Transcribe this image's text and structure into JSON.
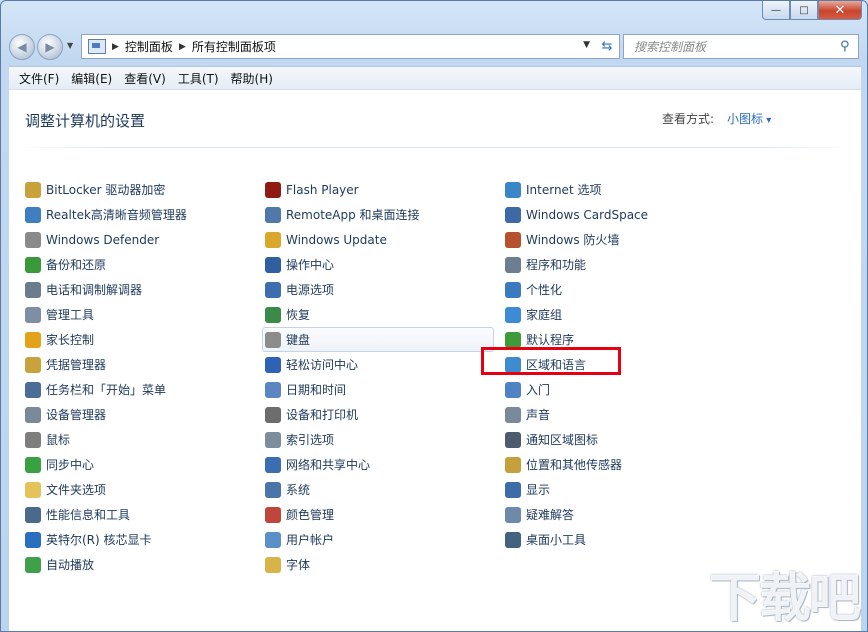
{
  "titlebar": {
    "minimize": "0",
    "maximize": "1",
    "close": "r"
  },
  "nav": {
    "back_glyph": "◀",
    "forward_glyph": "▶",
    "crumbs": [
      "控制面板",
      "所有控制面板项"
    ],
    "search_placeholder": "搜索控制面板"
  },
  "menu": [
    "文件(F)",
    "编辑(E)",
    "查看(V)",
    "工具(T)",
    "帮助(H)"
  ],
  "page": {
    "title": "调整计算机的设置",
    "viewby_label": "查看方式:",
    "viewby_value": "小图标"
  },
  "columns": [
    [
      {
        "label": "BitLocker 驱动器加密",
        "icon": "bitlocker-icon",
        "color": "#c9a13b"
      },
      {
        "label": "Realtek高清晰音频管理器",
        "icon": "realtek-speaker-icon",
        "color": "#3f7fbf"
      },
      {
        "label": "Windows Defender",
        "icon": "defender-icon",
        "color": "#8a8a8a"
      },
      {
        "label": "备份和还原",
        "icon": "backup-icon",
        "color": "#3a9a3a"
      },
      {
        "label": "电话和调制解调器",
        "icon": "phone-modem-icon",
        "color": "#6b7c8f"
      },
      {
        "label": "管理工具",
        "icon": "admin-tools-icon",
        "color": "#7d8ea5"
      },
      {
        "label": "家长控制",
        "icon": "parental-control-icon",
        "color": "#e3a21a"
      },
      {
        "label": "凭据管理器",
        "icon": "credential-icon",
        "color": "#c8a23a"
      },
      {
        "label": "任务栏和「开始」菜单",
        "icon": "taskbar-icon",
        "color": "#4b6d96"
      },
      {
        "label": "设备管理器",
        "icon": "device-manager-icon",
        "color": "#7a8a9b"
      },
      {
        "label": "鼠标",
        "icon": "mouse-icon",
        "color": "#7e7e7e"
      },
      {
        "label": "同步中心",
        "icon": "sync-icon",
        "color": "#3aa142"
      },
      {
        "label": "文件夹选项",
        "icon": "folder-options-icon",
        "color": "#e6c25a"
      },
      {
        "label": "性能信息和工具",
        "icon": "performance-icon",
        "color": "#4a6a8c"
      },
      {
        "label": "英特尔(R) 核芯显卡",
        "icon": "intel-graphics-icon",
        "color": "#2a6fbf"
      },
      {
        "label": "自动播放",
        "icon": "autoplay-icon",
        "color": "#3ea04a"
      }
    ],
    [
      {
        "label": "Flash Player",
        "icon": "flash-icon",
        "color": "#8f1c13"
      },
      {
        "label": "RemoteApp 和桌面连接",
        "icon": "remoteapp-icon",
        "color": "#4f79a8"
      },
      {
        "label": "Windows Update",
        "icon": "windows-update-icon",
        "color": "#d9a72a"
      },
      {
        "label": "操作中心",
        "icon": "action-center-flag-icon",
        "color": "#2f5f9e"
      },
      {
        "label": "电源选项",
        "icon": "power-options-icon",
        "color": "#3d6fb0"
      },
      {
        "label": "恢复",
        "icon": "recovery-icon",
        "color": "#3a8a4a"
      },
      {
        "label": "键盘",
        "icon": "keyboard-icon",
        "color": "#8c8c8c"
      },
      {
        "label": "轻松访问中心",
        "icon": "ease-of-access-icon",
        "color": "#2f62b5"
      },
      {
        "label": "日期和时间",
        "icon": "date-time-icon",
        "color": "#5b86c2"
      },
      {
        "label": "设备和打印机",
        "icon": "printer-icon",
        "color": "#6d6d6d"
      },
      {
        "label": "索引选项",
        "icon": "indexing-icon",
        "color": "#7c8d9e"
      },
      {
        "label": "网络和共享中心",
        "icon": "network-icon",
        "color": "#3b6db3"
      },
      {
        "label": "系统",
        "icon": "system-icon",
        "color": "#4b74a8"
      },
      {
        "label": "颜色管理",
        "icon": "color-management-icon",
        "color": "#c0453a"
      },
      {
        "label": "用户帐户",
        "icon": "user-accounts-icon",
        "color": "#5a8fc7"
      },
      {
        "label": "字体",
        "icon": "fonts-icon",
        "color": "#d8b34a"
      }
    ],
    [
      {
        "label": "Internet 选项",
        "icon": "internet-options-icon",
        "color": "#3b86c6"
      },
      {
        "label": "Windows CardSpace",
        "icon": "cardspace-icon",
        "color": "#3d6aa5"
      },
      {
        "label": "Windows 防火墙",
        "icon": "firewall-icon",
        "color": "#b5512d"
      },
      {
        "label": "程序和功能",
        "icon": "programs-icon",
        "color": "#6d7e92"
      },
      {
        "label": "个性化",
        "icon": "personalization-icon",
        "color": "#3c7ac0"
      },
      {
        "label": "家庭组",
        "icon": "homegroup-icon",
        "color": "#3d8ad6"
      },
      {
        "label": "默认程序",
        "icon": "default-programs-icon",
        "color": "#3f9a3a"
      },
      {
        "label": "区域和语言",
        "icon": "region-language-icon",
        "color": "#3f8bd0"
      },
      {
        "label": "入门",
        "icon": "getting-started-icon",
        "color": "#4f84c4"
      },
      {
        "label": "声音",
        "icon": "sound-icon",
        "color": "#7a8a9a"
      },
      {
        "label": "通知区域图标",
        "icon": "notification-area-icon",
        "color": "#4b5c6e"
      },
      {
        "label": "位置和其他传感器",
        "icon": "location-sensors-icon",
        "color": "#c6a03c"
      },
      {
        "label": "显示",
        "icon": "display-icon",
        "color": "#3c6da9"
      },
      {
        "label": "疑难解答",
        "icon": "troubleshooting-icon",
        "color": "#6e8aa8"
      },
      {
        "label": "桌面小工具",
        "icon": "gadgets-icon",
        "color": "#44627f"
      }
    ]
  ],
  "watermark": "下载吧"
}
